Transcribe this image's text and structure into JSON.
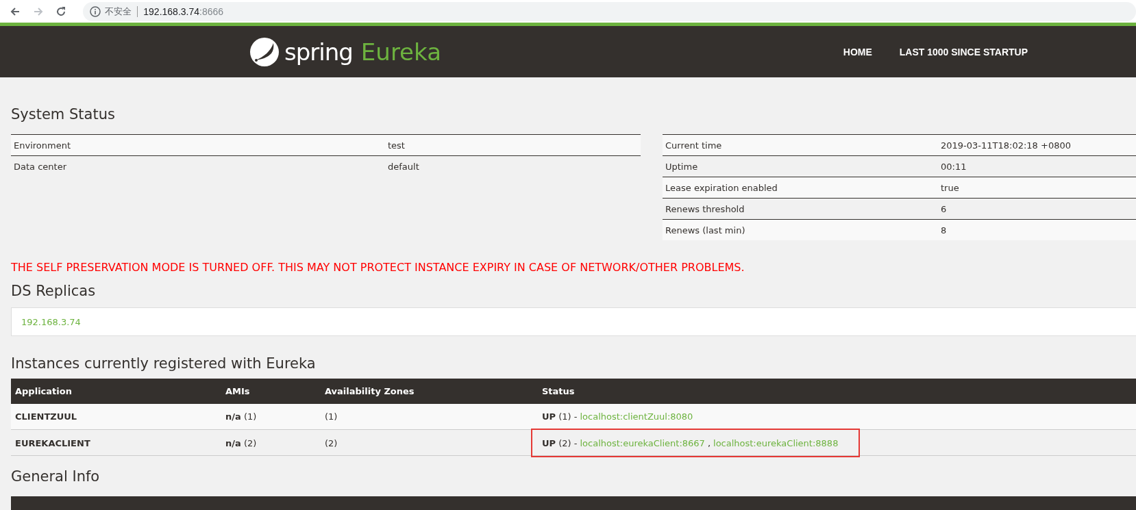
{
  "browser": {
    "buttons": [
      {
        "kind": "back",
        "disabled": false
      },
      {
        "kind": "forward",
        "disabled": true
      },
      {
        "kind": "reload",
        "disabled": false
      }
    ],
    "security_label": "不安全",
    "url_host": "192.168.3.74",
    "url_port": ":8666"
  },
  "header": {
    "brand": "spring",
    "product": "Eureka",
    "nav": [
      "HOME",
      "LAST 1000 SINCE STARTUP"
    ]
  },
  "system_status": {
    "title": "System Status",
    "left": [
      {
        "label": "Environment",
        "value": "test"
      },
      {
        "label": "Data center",
        "value": "default"
      }
    ],
    "right": [
      {
        "label": "Current time",
        "value": "2019-03-11T18:02:18 +0800"
      },
      {
        "label": "Uptime",
        "value": "00:11"
      },
      {
        "label": "Lease expiration enabled",
        "value": "true"
      },
      {
        "label": "Renews threshold",
        "value": "6"
      },
      {
        "label": "Renews (last min)",
        "value": "8"
      }
    ]
  },
  "warning": "THE SELF PRESERVATION MODE IS TURNED OFF. THIS MAY NOT PROTECT INSTANCE EXPIRY IN CASE OF NETWORK/OTHER PROBLEMS.",
  "ds_replicas": {
    "title": "DS Replicas",
    "items": [
      "192.168.3.74"
    ]
  },
  "instances": {
    "title": "Instances currently registered with Eureka",
    "columns": [
      "Application",
      "AMIs",
      "Availability Zones",
      "Status"
    ],
    "rows": [
      {
        "application": "CLIENTZUUL",
        "amis": "**n/a** (1)",
        "zones": "(1)",
        "status": "**UP** (1) -",
        "links": [
          "localhost:clientZuul:8080"
        ],
        "highlighted": false
      },
      {
        "application": "EUREKACLIENT",
        "amis": "**n/a** (2)",
        "zones": "(2)",
        "status": "**UP** (2) -",
        "links": [
          "localhost:eurekaClient:8667",
          "localhost:eurekaClient:8888"
        ],
        "link_separator": ",",
        "highlighted": true
      }
    ]
  },
  "general_info": {
    "title": "General Info"
  }
}
